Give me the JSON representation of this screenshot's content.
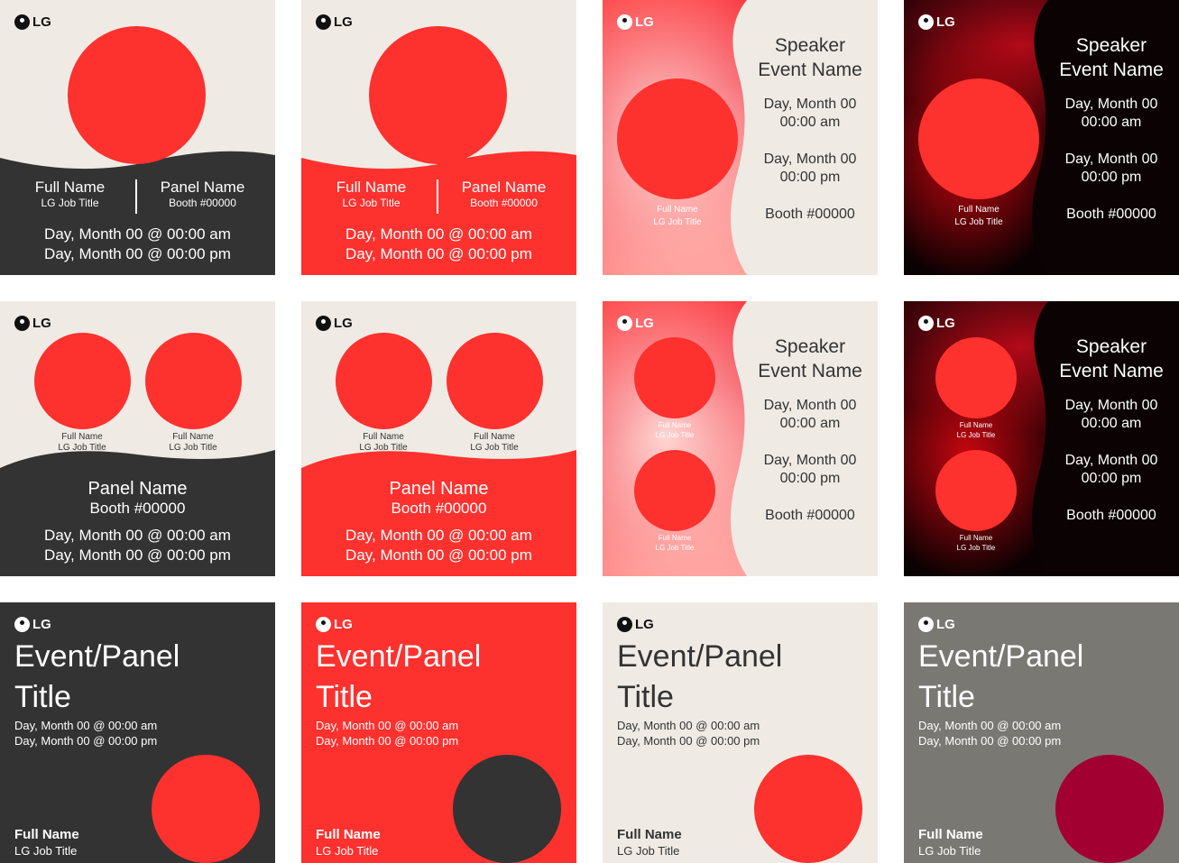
{
  "brand": "LG",
  "colors": {
    "red": "#fd312e",
    "dark": "#333333",
    "cream": "#efebe4",
    "gray": "#7a7873",
    "wine": "#a20030"
  },
  "single_speaker": {
    "name": "Full Name",
    "job": "LG Job Title",
    "panel": "Panel Name",
    "booth": "Booth #00000",
    "date_am": "Day, Month 00 @ 00:00 am",
    "date_pm": "Day, Month 00 @ 00:00 pm"
  },
  "side_event": {
    "speaker": "Speaker",
    "event": "Event Name",
    "date1": "Day, Month 00",
    "time1": "00:00 am",
    "date2": "Day, Month 00",
    "time2": "00:00 pm",
    "booth": "Booth #00000",
    "name": "Full Name",
    "job": "LG Job Title"
  },
  "title_card": {
    "title_line1": "Event/Panel",
    "title_line2": "Title",
    "date_am": "Day, Month 00 @ 00:00 am",
    "date_pm": "Day, Month 00 @ 00:00 pm",
    "name": "Full Name",
    "job": "LG Job Title"
  }
}
